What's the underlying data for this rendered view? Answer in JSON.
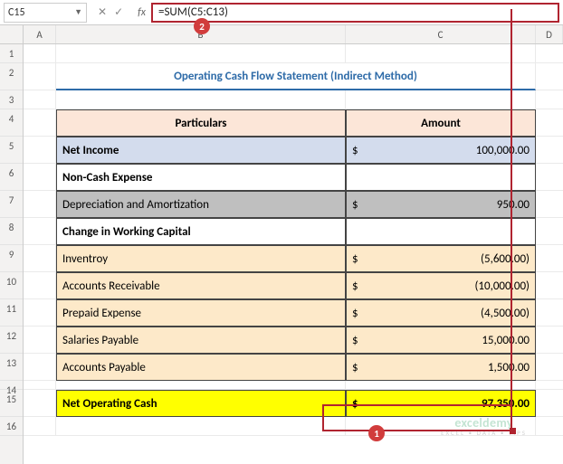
{
  "namebox": {
    "value": "C15"
  },
  "formula_bar": {
    "formula": "=SUM(C5:C13)"
  },
  "badges": {
    "b1": "1",
    "b2": "2"
  },
  "columns": {
    "A": "A",
    "B": "B",
    "C": "C",
    "D": "D"
  },
  "rows": {
    "r1": "1",
    "r2": "2",
    "r3": "3",
    "r4": "4",
    "r5": "5",
    "r6": "6",
    "r7": "7",
    "r8": "8",
    "r9": "9",
    "r10": "10",
    "r11": "11",
    "r12": "12",
    "r13": "13",
    "r14": "14",
    "r15": "15",
    "r16": "16"
  },
  "title": "Operating Cash Flow Statement (Indirect Method)",
  "headers": {
    "particulars": "Particulars",
    "amount": "Amount"
  },
  "currency": "$",
  "items": {
    "net_income": {
      "label": "Net Income",
      "value": "100,000.00"
    },
    "noncash_header": {
      "label": "Non-Cash Expense",
      "value": ""
    },
    "depreciation": {
      "label": "Depreciation and Amortization",
      "value": "950.00"
    },
    "wc_header": {
      "label": "Change in Working Capital",
      "value": ""
    },
    "inventory": {
      "label": "Inventroy",
      "value": "(5,600.00)"
    },
    "ar": {
      "label": "Accounts Receivable",
      "value": "(10,000.00)"
    },
    "prepaid": {
      "label": "Prepaid Expense",
      "value": "(4,500.00)"
    },
    "salaries": {
      "label": "Salaries Payable",
      "value": "15,000.00"
    },
    "ap": {
      "label": "Accounts Payable",
      "value": "1,500.00"
    },
    "net_op": {
      "label": "Net Operating Cash",
      "value": "97,350.00"
    }
  },
  "watermark": {
    "line1": "exceldemy",
    "line2": "EXCEL • DATA • TIPS"
  },
  "fx_controls": {
    "cancel": "✕",
    "confirm": "✓",
    "fx": "fx"
  },
  "chart_data": {
    "type": "table",
    "title": "Operating Cash Flow Statement (Indirect Method)",
    "columns": [
      "Particulars",
      "Amount"
    ],
    "rows": [
      [
        "Net Income",
        100000.0
      ],
      [
        "Non-Cash Expense",
        null
      ],
      [
        "Depreciation and Amortization",
        950.0
      ],
      [
        "Change in Working Capital",
        null
      ],
      [
        "Inventroy",
        -5600.0
      ],
      [
        "Accounts Receivable",
        -10000.0
      ],
      [
        "Prepaid Expense",
        -4500.0
      ],
      [
        "Salaries Payable",
        15000.0
      ],
      [
        "Accounts Payable",
        1500.0
      ],
      [
        "Net Operating Cash",
        97350.0
      ]
    ],
    "formula_cell": {
      "address": "C15",
      "formula": "=SUM(C5:C13)",
      "result": 97350.0
    }
  }
}
